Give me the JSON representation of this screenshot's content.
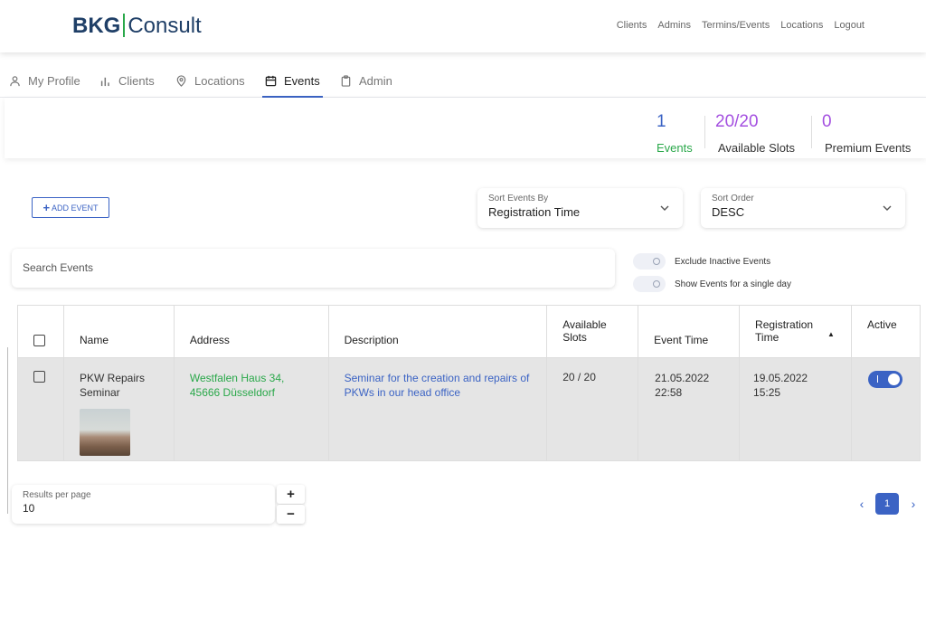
{
  "brand": {
    "part1": "BKG",
    "part2": "Consult"
  },
  "topnav": [
    "Clients",
    "Admins",
    "Termins/Events",
    "Locations",
    "Logout"
  ],
  "tabs": [
    {
      "label": "My Profile",
      "icon": "user-icon"
    },
    {
      "label": "Clients",
      "icon": "bar-chart-icon"
    },
    {
      "label": "Locations",
      "icon": "location-pin-icon"
    },
    {
      "label": "Events",
      "icon": "calendar-icon",
      "active": true
    },
    {
      "label": "Admin",
      "icon": "clipboard-icon"
    }
  ],
  "stats": [
    {
      "value": "1",
      "label": "Events",
      "value_color": "#3b63c4",
      "label_color": "#2aa84a"
    },
    {
      "value": "20/20",
      "label": "Available Slots",
      "value_color": "#a450e0"
    },
    {
      "value": "0",
      "label": "Premium Events",
      "value_color": "#a450e0"
    }
  ],
  "add_event_label": "ADD EVENT",
  "sort_by": {
    "label": "Sort Events By",
    "value": "Registration Time"
  },
  "sort_order": {
    "label": "Sort Order",
    "value": "DESC"
  },
  "search_placeholder": "Search Events",
  "toggles": {
    "exclude_inactive": "Exclude Inactive Events",
    "single_day": "Show Events for a single day"
  },
  "table": {
    "headers": {
      "name": "Name",
      "address": "Address",
      "description": "Description",
      "slots_line1": "Available",
      "slots_line2": "Slots",
      "event_time": "Event Time",
      "reg_line1": "Registration",
      "reg_line2": "Time",
      "active": "Active"
    },
    "rows": [
      {
        "name_line1": "PKW Repairs",
        "name_line2": "Seminar",
        "address_line1": "Westfalen Haus 34,",
        "address_line2": "45666 Düsseldorf",
        "description_line1": "Seminar for the creation and repairs of",
        "description_line2": "PKWs in our head office",
        "slots": "20 / 20",
        "event_date": "21.05.2022",
        "event_clock": "22:58",
        "reg_date": "19.05.2022",
        "reg_clock": "15:25",
        "active": true
      }
    ]
  },
  "results_per_page": {
    "label": "Results per page",
    "value": "10"
  },
  "pagination": {
    "current": "1"
  }
}
